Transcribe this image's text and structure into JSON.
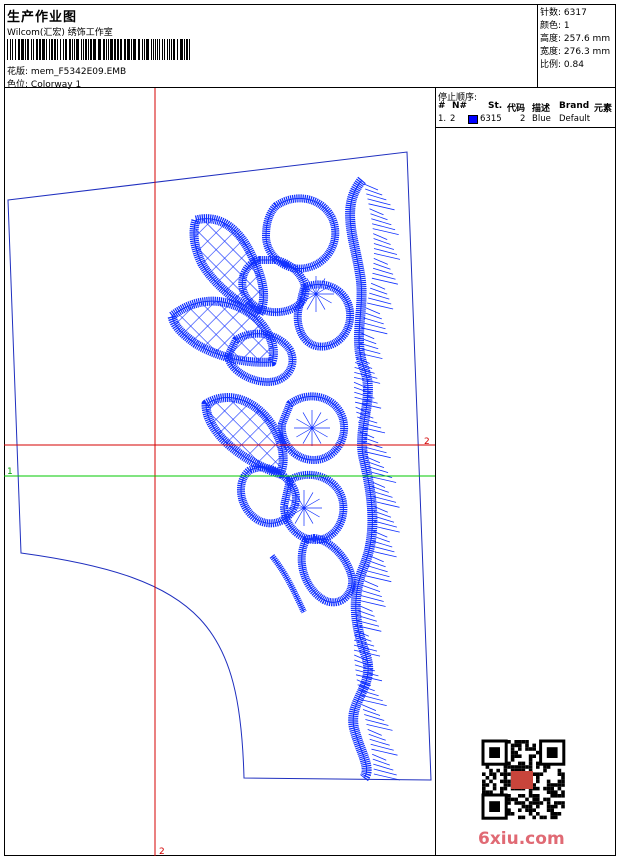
{
  "header": {
    "title": "生产作业图",
    "company": "Wilcom(汇宏) 绣饰工作室",
    "design_label": "花版:",
    "design_name": "mem_F5342E09.EMB",
    "colorway_label": "色位:",
    "colorway_name": "Colorway 1"
  },
  "stats": [
    {
      "label": "针数:",
      "value": "6317"
    },
    {
      "label": "颜色:",
      "value": "1"
    },
    {
      "label": "高度:",
      "value": "257.6 mm"
    },
    {
      "label": "宽度:",
      "value": "276.3 mm"
    },
    {
      "label": "比例:",
      "value": "0.84"
    }
  ],
  "stop_sequence": {
    "title": "停止顺序:",
    "columns": [
      "#",
      "N#",
      "St.",
      "代码",
      "描述",
      "Brand",
      "元素"
    ],
    "rows": [
      {
        "index": "1.",
        "needle": "2",
        "swatch_color": "#0000ff",
        "stitches": "6315",
        "code": "2",
        "description": "Blue",
        "brand": "Default",
        "element": ""
      }
    ]
  },
  "markers": {
    "vertical_red": "2",
    "horizontal_red": "2",
    "horizontal_green": "1"
  },
  "colors": {
    "outline": "#1f2fbf",
    "embroidery": "#1030ff",
    "red_line": "#d40000",
    "green_line": "#00c800"
  },
  "watermark": {
    "text": "6xiu.com"
  }
}
